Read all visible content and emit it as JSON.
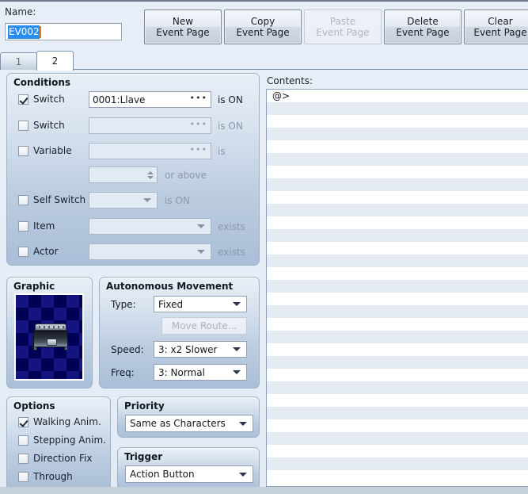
{
  "window": {
    "name_label": "Name:",
    "name_value": "EV002"
  },
  "toolbar": {
    "buttons": [
      {
        "line1": "New",
        "line2": "Event Page",
        "enabled": true
      },
      {
        "line1": "Copy",
        "line2": "Event Page",
        "enabled": true
      },
      {
        "line1": "Paste",
        "line2": "Event Page",
        "enabled": false
      },
      {
        "line1": "Delete",
        "line2": "Event Page",
        "enabled": true
      },
      {
        "line1": "Clear",
        "line2": "Event Page",
        "enabled": true
      }
    ]
  },
  "tabs": {
    "items": [
      {
        "label": "1",
        "active": false
      },
      {
        "label": "2",
        "active": true
      }
    ]
  },
  "conditions": {
    "title": "Conditions",
    "switch1": {
      "label": "Switch",
      "checked": true,
      "value": "0001:Llave",
      "button": "•••",
      "suffix": "is ON"
    },
    "switch2": {
      "label": "Switch",
      "checked": false,
      "value": "",
      "button": "•••",
      "suffix": "is ON"
    },
    "variable": {
      "label": "Variable",
      "checked": false,
      "value": "",
      "button": "•••",
      "suffix": "is"
    },
    "variable_value": {
      "value": "",
      "suffix": "or above"
    },
    "self_switch": {
      "label": "Self Switch",
      "checked": false,
      "value": "",
      "suffix": "is ON"
    },
    "item": {
      "label": "Item",
      "checked": false,
      "value": "",
      "suffix": "exists"
    },
    "actor": {
      "label": "Actor",
      "checked": false,
      "value": "",
      "suffix": "exists"
    }
  },
  "graphic": {
    "title": "Graphic",
    "sprite": "treasure-chest"
  },
  "autonomous_movement": {
    "title": "Autonomous Movement",
    "type_label": "Type:",
    "type_value": "Fixed",
    "move_route_button": "Move Route...",
    "move_route_enabled": false,
    "speed_label": "Speed:",
    "speed_value": "3: x2 Slower",
    "freq_label": "Freq:",
    "freq_value": "3: Normal"
  },
  "options": {
    "title": "Options",
    "items": [
      {
        "label": "Walking Anim.",
        "checked": true
      },
      {
        "label": "Stepping Anim.",
        "checked": false
      },
      {
        "label": "Direction Fix",
        "checked": false
      },
      {
        "label": "Through",
        "checked": false
      }
    ]
  },
  "priority": {
    "title": "Priority",
    "value": "Same as Characters"
  },
  "trigger": {
    "title": "Trigger",
    "value": "Action Button"
  },
  "contents": {
    "label": "Contents:",
    "rows": [
      "@>",
      "",
      "",
      "",
      "",
      "",
      "",
      "",
      "",
      "",
      "",
      "",
      "",
      "",
      "",
      "",
      "",
      "",
      "",
      "",
      "",
      "",
      "",
      "",
      "",
      "",
      "",
      "",
      "",
      "",
      ""
    ]
  },
  "colors": {
    "accent": "#2a8ef0",
    "caret": "#e07b1e",
    "group_border": "#9db2cb",
    "panel_bg": "#e8eef7",
    "sprite_dark": "#000055",
    "sprite_light": "#141480"
  }
}
